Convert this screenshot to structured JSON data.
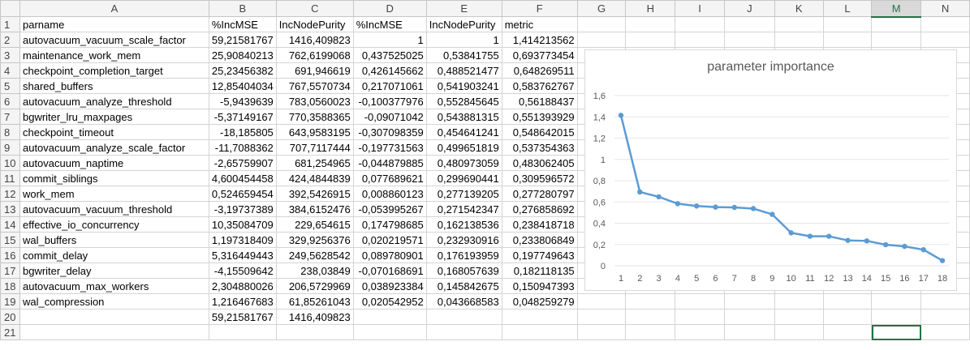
{
  "columns": [
    "A",
    "B",
    "C",
    "D",
    "E",
    "F",
    "G",
    "H",
    "I",
    "J",
    "K",
    "L",
    "M",
    "N"
  ],
  "selected_column": "M",
  "rows": [
    {
      "n": "1",
      "c": [
        "parname",
        "%IncMSE",
        "IncNodePurity",
        "%IncMSE",
        "IncNodePurity",
        "metric",
        "",
        "",
        "",
        "",
        "",
        "",
        "",
        ""
      ]
    },
    {
      "n": "2",
      "c": [
        "autovacuum_vacuum_scale_factor",
        "59,21581767",
        "1416,409823",
        "1",
        "1",
        "1,414213562",
        "",
        "",
        "",
        "",
        "",
        "",
        "",
        ""
      ]
    },
    {
      "n": "3",
      "c": [
        "maintenance_work_mem",
        "25,90840213",
        "762,6199068",
        "0,437525025",
        "0,53841755",
        "0,693773454",
        "",
        "",
        "",
        "",
        "",
        "",
        "",
        ""
      ]
    },
    {
      "n": "4",
      "c": [
        "checkpoint_completion_target",
        "25,23456382",
        "691,946619",
        "0,426145662",
        "0,488521477",
        "0,648269511",
        "",
        "",
        "",
        "",
        "",
        "",
        "",
        ""
      ]
    },
    {
      "n": "5",
      "c": [
        "shared_buffers",
        "12,85404034",
        "767,5570734",
        "0,217071061",
        "0,541903241",
        "0,583762767",
        "",
        "",
        "",
        "",
        "",
        "",
        "",
        ""
      ]
    },
    {
      "n": "6",
      "c": [
        "autovacuum_analyze_threshold",
        "-5,9439639",
        "783,0560023",
        "-0,100377976",
        "0,552845645",
        "0,56188437",
        "",
        "",
        "",
        "",
        "",
        "",
        "",
        ""
      ]
    },
    {
      "n": "7",
      "c": [
        "bgwriter_lru_maxpages",
        "-5,37149167",
        "770,3588365",
        "-0,09071042",
        "0,543881315",
        "0,551393929",
        "",
        "",
        "",
        "",
        "",
        "",
        "",
        ""
      ]
    },
    {
      "n": "8",
      "c": [
        "checkpoint_timeout",
        "-18,185805",
        "643,9583195",
        "-0,307098359",
        "0,454641241",
        "0,548642015",
        "",
        "",
        "",
        "",
        "",
        "",
        "",
        ""
      ]
    },
    {
      "n": "9",
      "c": [
        "autovacuum_analyze_scale_factor",
        "-11,7088362",
        "707,7117444",
        "-0,197731563",
        "0,499651819",
        "0,537354363",
        "",
        "",
        "",
        "",
        "",
        "",
        "",
        ""
      ]
    },
    {
      "n": "10",
      "c": [
        "autovacuum_naptime",
        "-2,65759907",
        "681,254965",
        "-0,044879885",
        "0,480973059",
        "0,483062405",
        "",
        "",
        "",
        "",
        "",
        "",
        "",
        ""
      ]
    },
    {
      "n": "11",
      "c": [
        "commit_siblings",
        "4,600454458",
        "424,4844839",
        "0,077689621",
        "0,299690441",
        "0,309596572",
        "",
        "",
        "",
        "",
        "",
        "",
        "",
        ""
      ]
    },
    {
      "n": "12",
      "c": [
        "work_mem",
        "0,524659454",
        "392,5426915",
        "0,008860123",
        "0,277139205",
        "0,277280797",
        "",
        "",
        "",
        "",
        "",
        "",
        "",
        ""
      ]
    },
    {
      "n": "13",
      "c": [
        "autovacuum_vacuum_threshold",
        "-3,19737389",
        "384,6152476",
        "-0,053995267",
        "0,271542347",
        "0,276858692",
        "",
        "",
        "",
        "",
        "",
        "",
        "",
        ""
      ]
    },
    {
      "n": "14",
      "c": [
        "effective_io_concurrency",
        "10,35084709",
        "229,654615",
        "0,174798685",
        "0,162138536",
        "0,238418718",
        "",
        "",
        "",
        "",
        "",
        "",
        "",
        ""
      ]
    },
    {
      "n": "15",
      "c": [
        "wal_buffers",
        "1,197318409",
        "329,9256376",
        "0,020219571",
        "0,232930916",
        "0,233806849",
        "",
        "",
        "",
        "",
        "",
        "",
        "",
        ""
      ]
    },
    {
      "n": "16",
      "c": [
        "commit_delay",
        "5,316449443",
        "249,5628542",
        "0,089780901",
        "0,176193959",
        "0,197749643",
        "",
        "",
        "",
        "",
        "",
        "",
        "",
        ""
      ]
    },
    {
      "n": "17",
      "c": [
        "bgwriter_delay",
        "-4,15509642",
        "238,03849",
        "-0,070168691",
        "0,168057639",
        "0,182118135",
        "",
        "",
        "",
        "",
        "",
        "",
        "",
        ""
      ]
    },
    {
      "n": "18",
      "c": [
        "autovacuum_max_workers",
        "2,304880026",
        "206,5729969",
        "0,038923384",
        "0,145842675",
        "0,150947393",
        "",
        "",
        "",
        "",
        "",
        "",
        "",
        ""
      ]
    },
    {
      "n": "19",
      "c": [
        "wal_compression",
        "1,216467683",
        "61,85261043",
        "0,020542952",
        "0,043668583",
        "0,048259279",
        "",
        "",
        "",
        "",
        "",
        "",
        "",
        ""
      ]
    },
    {
      "n": "20",
      "c": [
        "",
        "59,21581767",
        "1416,409823",
        "",
        "",
        "",
        "",
        "",
        "",
        "",
        "",
        "",
        "",
        ""
      ]
    },
    {
      "n": "21",
      "c": [
        "",
        "",
        "",
        "",
        "",
        "",
        "",
        "",
        "",
        "",
        "",
        "",
        "",
        ""
      ]
    }
  ],
  "chart_data": {
    "type": "line",
    "title": "parameter importance",
    "x": [
      1,
      2,
      3,
      4,
      5,
      6,
      7,
      8,
      9,
      10,
      11,
      12,
      13,
      14,
      15,
      16,
      17,
      18
    ],
    "series": [
      {
        "values": [
          1.414213562,
          0.693773454,
          0.648269511,
          0.583762767,
          0.56188437,
          0.551393929,
          0.548642015,
          0.537354363,
          0.483062405,
          0.309596572,
          0.277280797,
          0.276858692,
          0.238418718,
          0.233806849,
          0.197749643,
          0.182118135,
          0.150947393,
          0.048259279
        ],
        "color": "#5b9bd5"
      }
    ],
    "y_ticks": [
      "0",
      "0,2",
      "0,4",
      "0,6",
      "0,8",
      "1",
      "1,2",
      "1,4",
      "1,6"
    ],
    "ylim": [
      0,
      1.6
    ],
    "grid": true
  }
}
